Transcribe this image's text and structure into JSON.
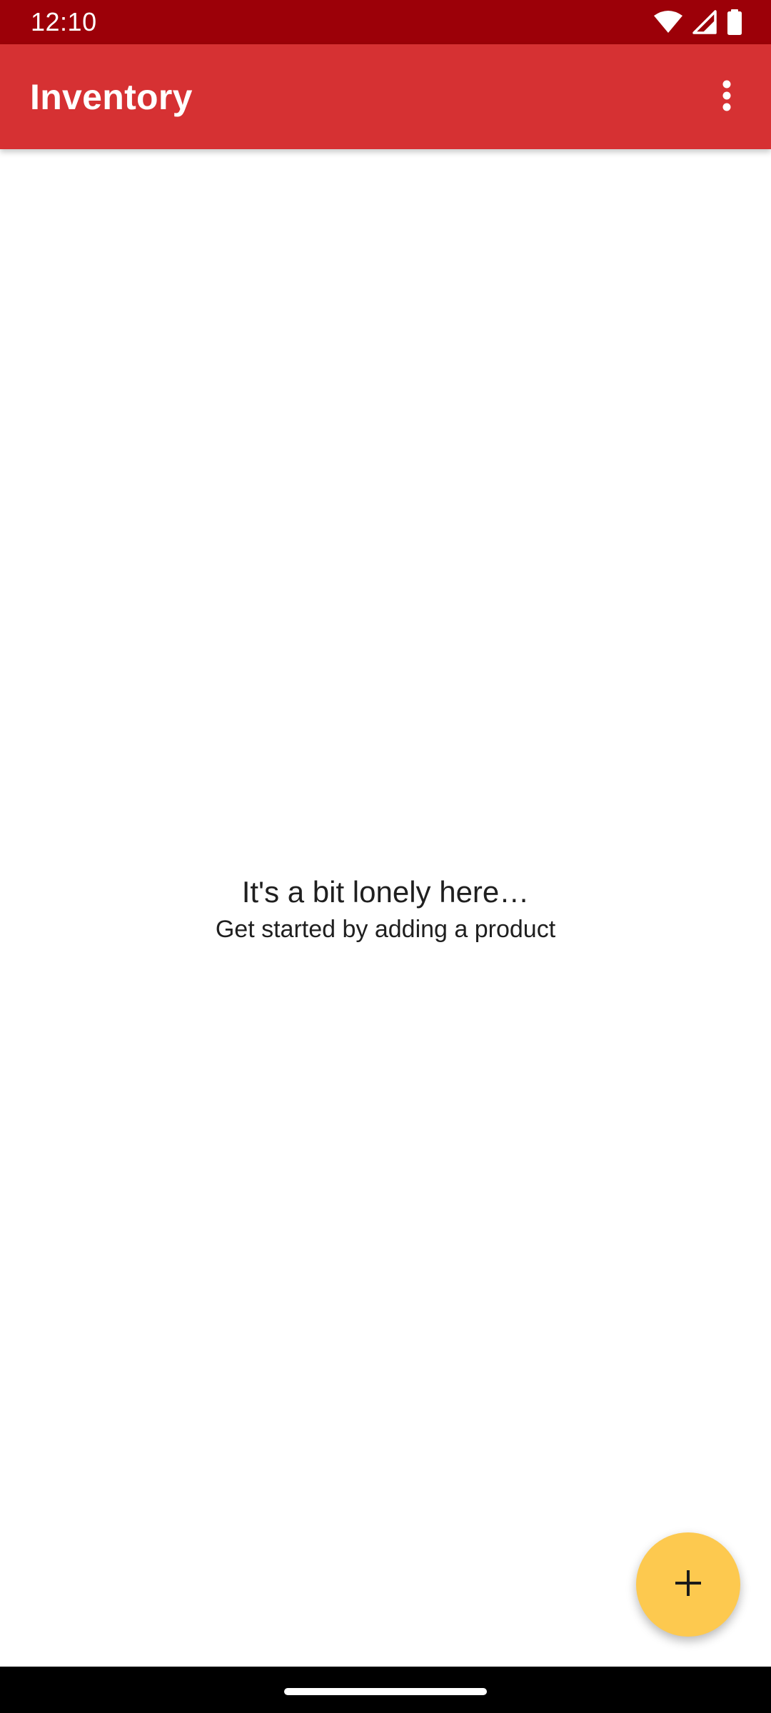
{
  "status_bar": {
    "time": "12:10",
    "icons": [
      "wifi-icon",
      "signal-icon",
      "battery-icon"
    ]
  },
  "app_bar": {
    "title": "Inventory",
    "overflow_icon": "more-vert-icon"
  },
  "empty_state": {
    "title": "It's a bit lonely here…",
    "subtitle": "Get started by adding a product"
  },
  "fab": {
    "icon": "add-icon"
  },
  "colors": {
    "status_bar": "#9c0008",
    "app_bar": "#d63133",
    "fab": "#fdc94f",
    "background": "#ffffff"
  }
}
